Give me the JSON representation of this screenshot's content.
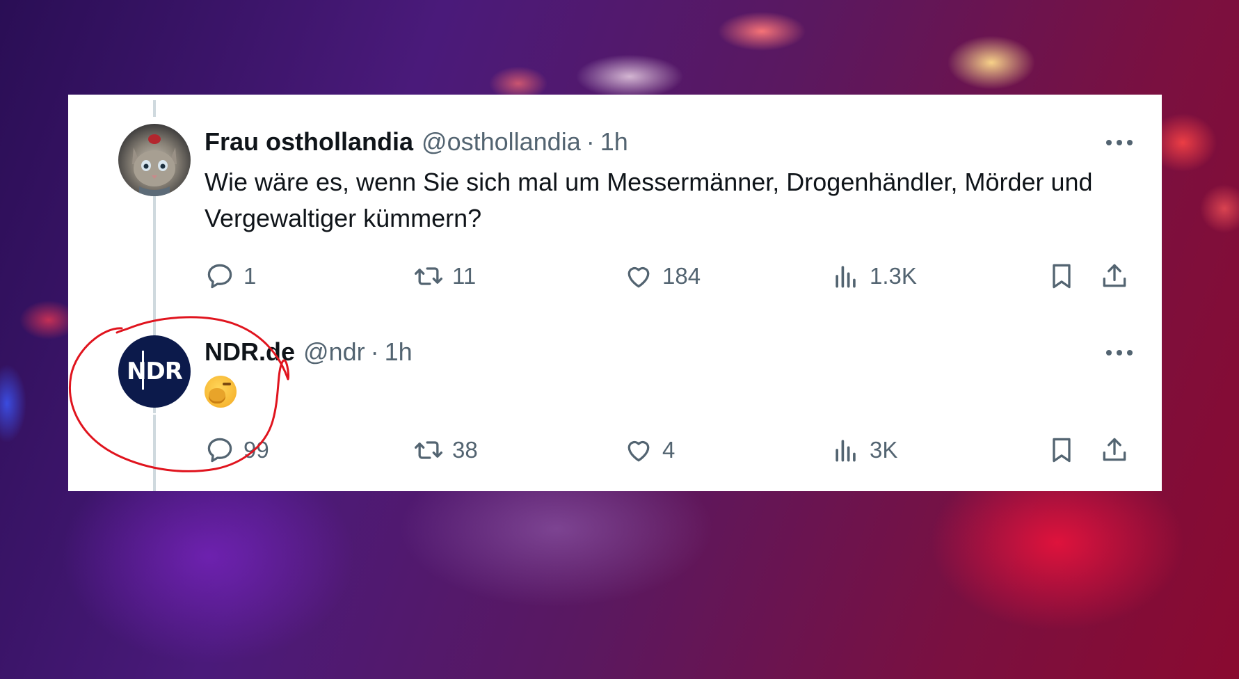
{
  "tweets": [
    {
      "name": "Frau osthollandia",
      "handle": "@osthollandia",
      "separator": "·",
      "time": "1h",
      "text": "Wie wäre es, wenn Sie sich mal um Messermänner, Drogenhändler, Mörder und Vergewaltiger kümmern?",
      "replies": "1",
      "retweets": "11",
      "likes": "184",
      "views": "1.3K",
      "avatar_icon": "cat-avatar"
    },
    {
      "name": "NDR.de",
      "handle": "@ndr",
      "separator": "·",
      "time": "1h",
      "emoji": "🥱",
      "replies": "99",
      "retweets": "38",
      "likes": "4",
      "views": "3K",
      "avatar_logo": "NDR"
    }
  ],
  "icons": {
    "reply": "speech-bubble-icon",
    "retweet": "retweet-icon",
    "like": "heart-icon",
    "views": "bar-chart-icon",
    "bookmark": "bookmark-icon",
    "share": "share-icon",
    "more": "more-dots-icon"
  },
  "colors": {
    "text_primary": "#0f1419",
    "text_secondary": "#536471",
    "thread_line": "#cfd9de",
    "ndr_blue": "#0c1a4b",
    "annotation_red": "#e0141e"
  }
}
